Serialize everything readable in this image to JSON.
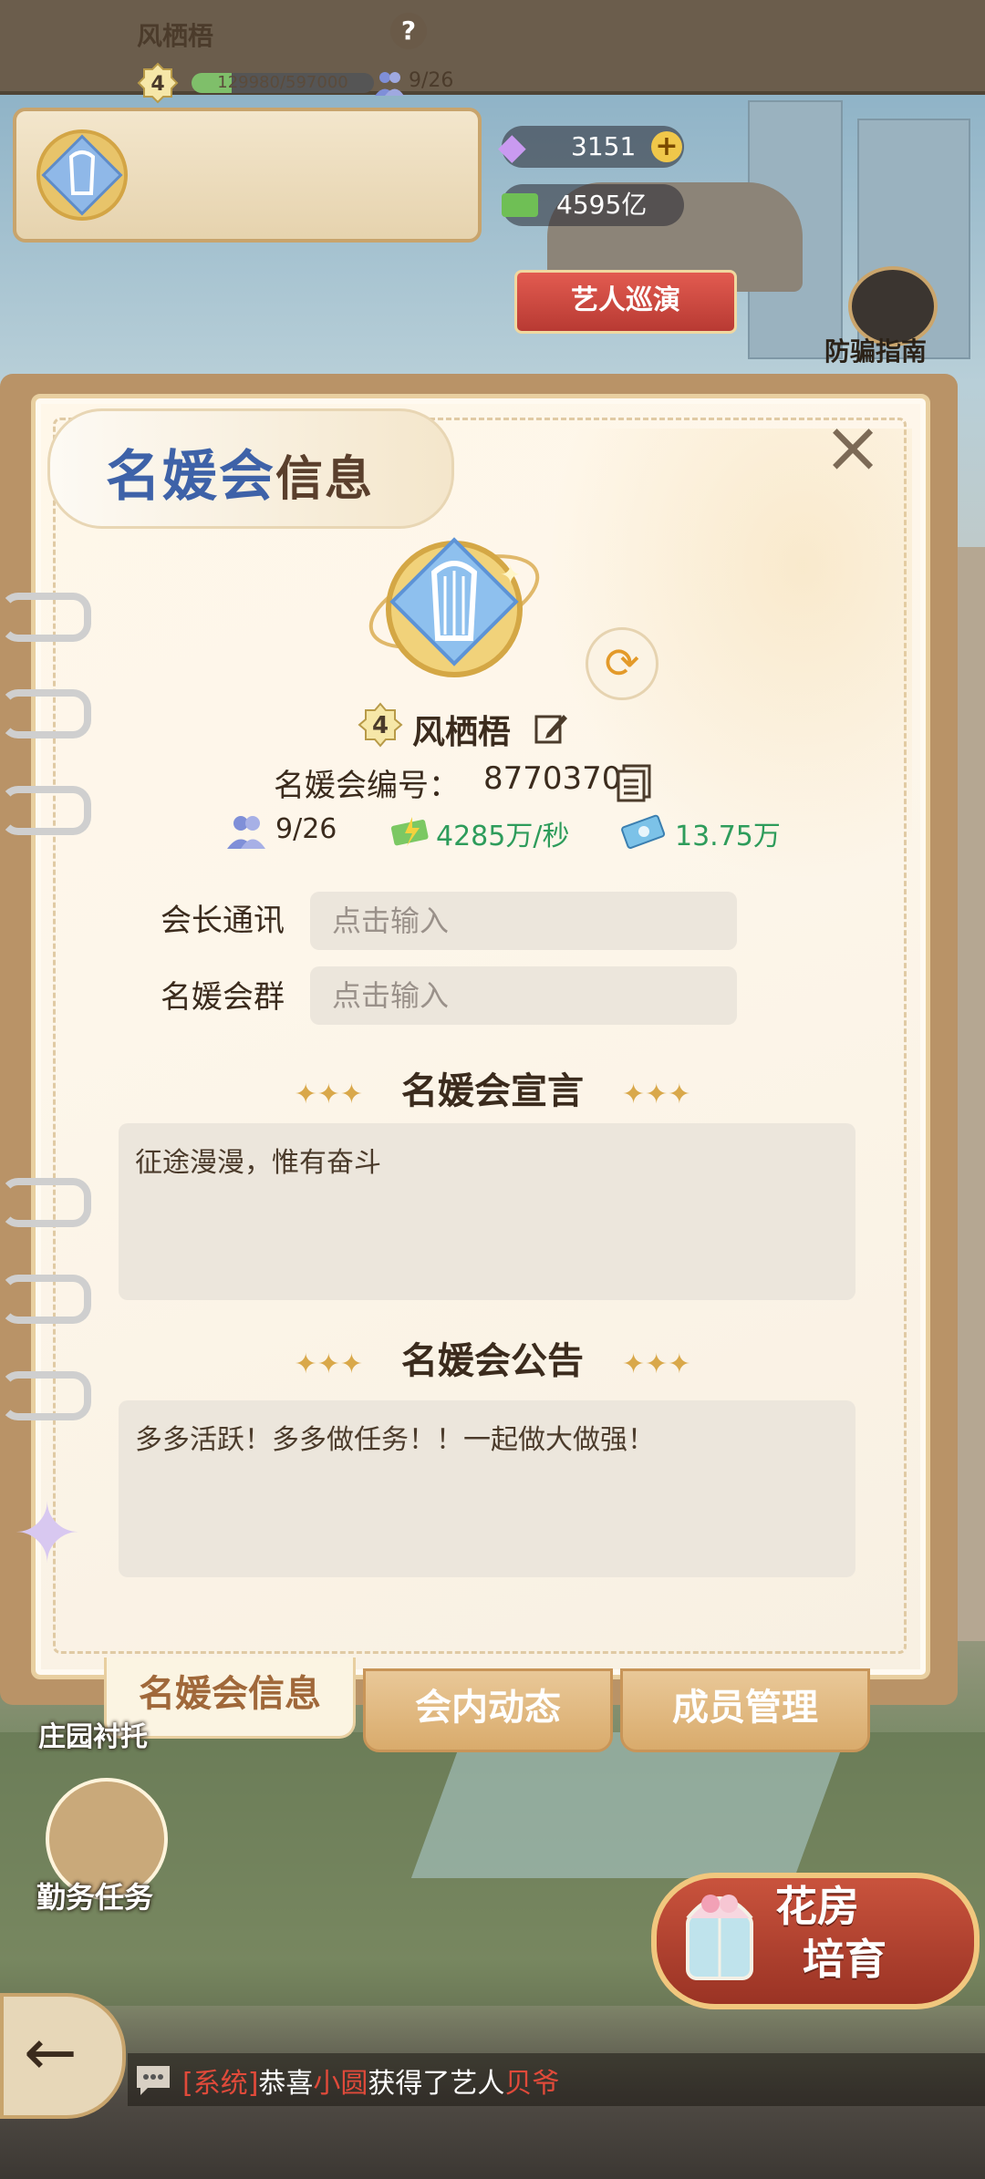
{
  "header": {
    "club_name": "风栖梧",
    "club_level": "4",
    "exp_text": "129980/597000",
    "exp_fraction": 0.218,
    "members": "9/26",
    "help_icon": "?"
  },
  "currencies": {
    "gems": "3151",
    "plus": "+",
    "cash": "4595亿"
  },
  "scene": {
    "tour_button": "艺人巡演",
    "fraud_guide": "防骗指南",
    "manor_label": "庄园衬托",
    "task_label": "勤务任务",
    "flower_button_line1": "花房",
    "flower_button_line2": "培育"
  },
  "panel": {
    "title_part1": "名媛会",
    "title_part2": "信息",
    "close": "×",
    "level": "4",
    "name": "风栖梧",
    "id_label": "名媛会编号：",
    "id_value": "8770370",
    "members": "9/26",
    "income_speed": "4285万/秒",
    "money": "13.75万",
    "leader_contact_label": "会长通讯",
    "leader_contact_placeholder": "点击输入",
    "group_label": "名媛会群",
    "group_placeholder": "点击输入",
    "declaration_title": "名媛会宣言",
    "declaration_text": "征途漫漫，惟有奋斗",
    "notice_title": "名媛会公告",
    "notice_text": "多多活跃！多多做任务！！一起做大做强！"
  },
  "tabs": [
    {
      "label": "名媛会信息",
      "active": true
    },
    {
      "label": "会内动态",
      "active": false
    },
    {
      "label": "成员管理",
      "active": false
    }
  ],
  "chat": {
    "tag": "[系统]",
    "text1": "恭喜",
    "user": "小圆",
    "text2": "获得了艺人",
    "artist": "贝爷"
  },
  "colors": {
    "title_blue": "#3e62a8",
    "green_value": "#2e9c5b",
    "tab_active": "#a0683a"
  }
}
